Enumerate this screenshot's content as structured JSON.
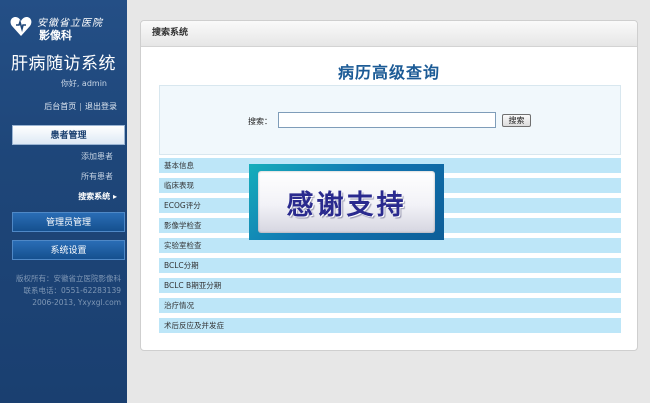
{
  "sidebar": {
    "logo": {
      "line1": "安徽省立医院",
      "line2": "影像科"
    },
    "system_title": "肝病随访系统",
    "greeting": "你好, admin",
    "links": {
      "home": "后台首页",
      "separator": "|",
      "logout": "退出登录"
    },
    "menu": {
      "patient_mgmt": "患者管理",
      "sub_items": [
        "添加患者",
        "所有患者",
        "搜索系统 ▸"
      ],
      "admin_mgmt": "管理员管理",
      "system_settings": "系统设置"
    },
    "copyright": [
      "版权所有：安徽省立医院影像科",
      "联系电话：0551-62283139",
      "2006-2013, Yxyxgl.com"
    ]
  },
  "panel": {
    "header": "搜索系统",
    "heading": "病历高级查询",
    "search": {
      "label": "搜索：",
      "value": "",
      "placeholder": "",
      "button": "搜索"
    },
    "categories": [
      "基本信息",
      "临床表现",
      "ECOG评分",
      "影像学检查",
      "实验室检查",
      "BCLC分期",
      "BCLC B期亚分期",
      "治疗情况",
      "术后反应及并发症"
    ]
  },
  "overlay": {
    "text": "感谢支持"
  },
  "colors": {
    "sidebar": "#1e4679",
    "heading": "#1c5b96",
    "category_row": "#bde6f8",
    "overlay_text": "#2a2a8e"
  }
}
